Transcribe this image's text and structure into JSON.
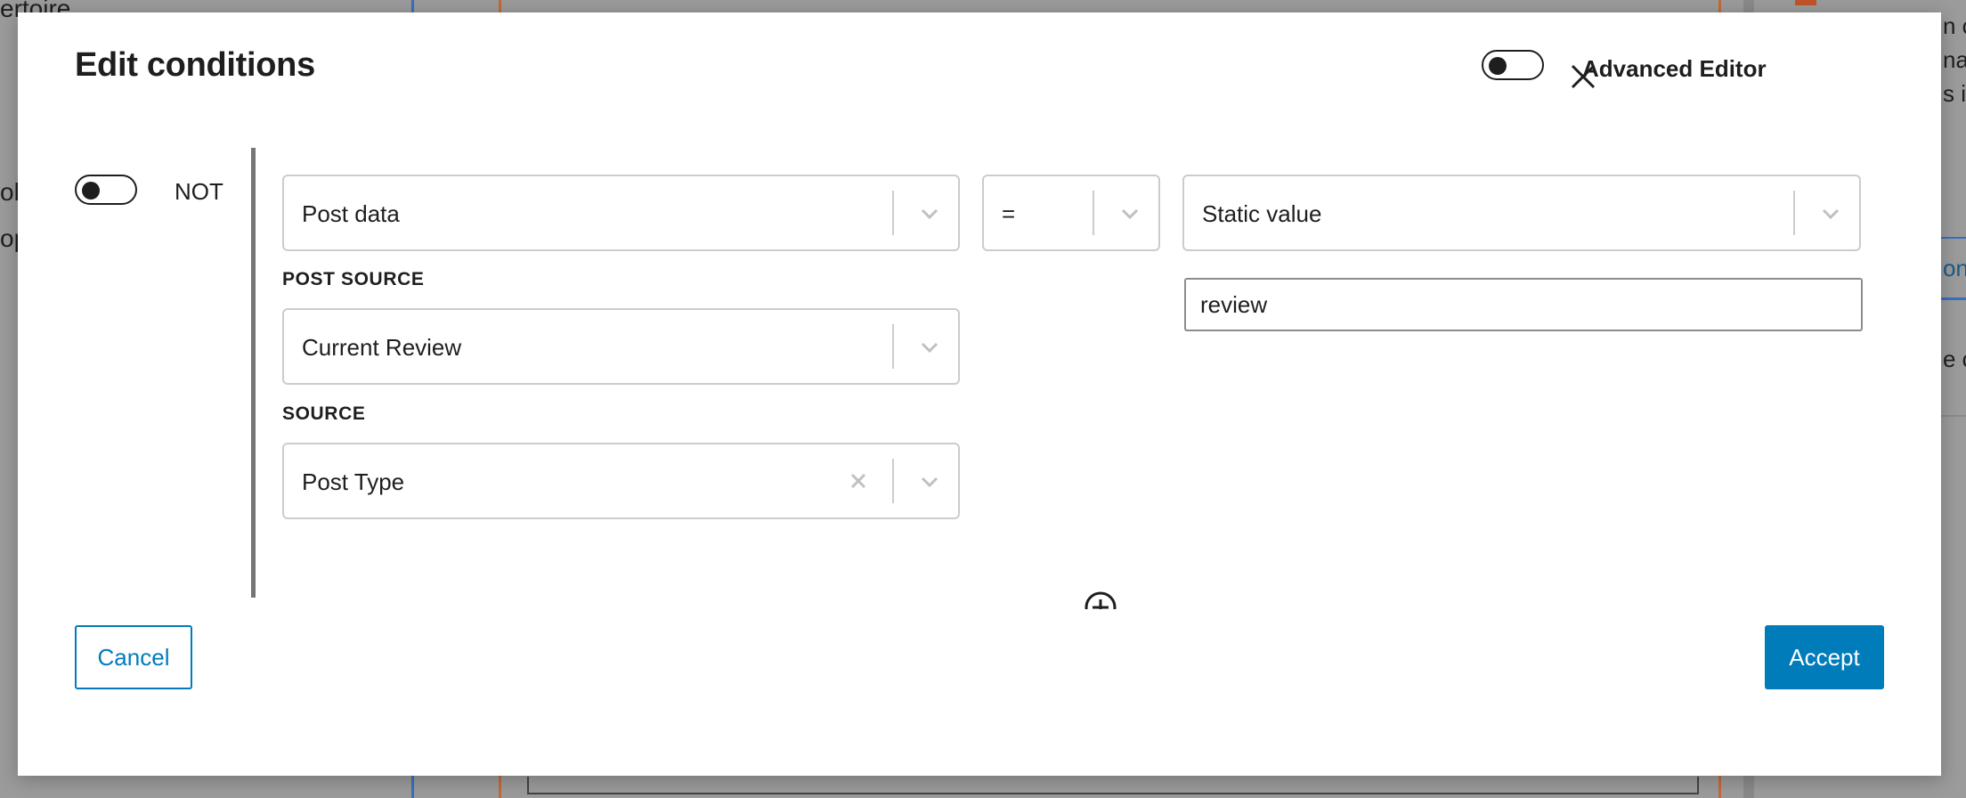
{
  "background": {
    "left_text": [
      "ertoire",
      "ol",
      "op"
    ],
    "right_text": [
      "n co",
      "na",
      "s i",
      "ons",
      "e c"
    ]
  },
  "dialog": {
    "title": "Edit conditions",
    "advanced_editor_label": "Advanced Editor",
    "advanced_editor_on": false,
    "not_label": "NOT",
    "not_on": false
  },
  "condition": {
    "left_select": "Post data",
    "operator_select": "=",
    "right_select": "Static value",
    "right_value": "review",
    "post_source_label": "POST SOURCE",
    "post_source_value": "Current Review",
    "source_label": "SOURCE",
    "source_value": "Post Type"
  },
  "footer": {
    "cancel_label": "Cancel",
    "accept_label": "Accept"
  },
  "colors": {
    "accent": "#007cba",
    "backdrop": "#9b9b9b"
  },
  "icons": {
    "close": "close-icon",
    "chevron": "chevron-down-icon",
    "clear": "clear-x-icon",
    "add": "add-circle-icon"
  }
}
